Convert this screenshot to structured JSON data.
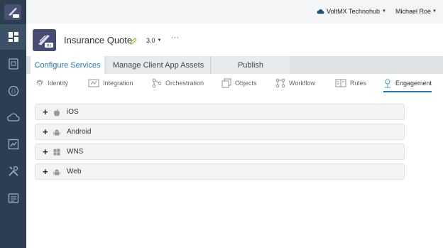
{
  "header": {
    "org_name": "VoltMX Technohub",
    "user_name": "Michael Roe"
  },
  "app": {
    "title": "Insurance Quote",
    "version": "3.0",
    "more": "···"
  },
  "main_tabs": [
    {
      "label": "Configure Services",
      "active": true
    },
    {
      "label": "Manage Client App Assets",
      "active": false
    },
    {
      "label": "Publish",
      "active": false
    }
  ],
  "sub_tabs": [
    {
      "label": "Identity",
      "icon": "fingerprint-icon"
    },
    {
      "label": "Integration",
      "icon": "integration-icon"
    },
    {
      "label": "Orchestration",
      "icon": "orchestration-icon"
    },
    {
      "label": "Objects",
      "icon": "objects-icon"
    },
    {
      "label": "Workflow",
      "icon": "workflow-icon"
    },
    {
      "label": "Rules",
      "icon": "rules-icon"
    },
    {
      "label": "Engagement",
      "icon": "engagement-icon",
      "active": true
    }
  ],
  "platforms": [
    {
      "label": "iOS",
      "icon": "apple-icon"
    },
    {
      "label": "Android",
      "icon": "android-icon"
    },
    {
      "label": "WNS",
      "icon": "windows-icon"
    },
    {
      "label": "Web",
      "icon": "android-icon"
    }
  ],
  "colors": {
    "rail": "#2c3e4f",
    "accent": "#1e7ab8",
    "logo": "#474c72"
  }
}
